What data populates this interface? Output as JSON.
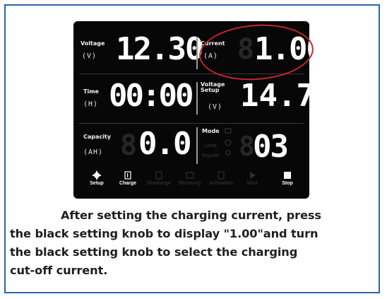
{
  "display": {
    "voltage": {
      "label": "Voltage",
      "unit": "(V)",
      "value": "12.30"
    },
    "current": {
      "label": "Current",
      "unit": "(A)",
      "value": "1.00"
    },
    "time": {
      "label": "Time",
      "unit": "(H)",
      "value": "00:00"
    },
    "voltage_setup": {
      "label": "Voltage Setup",
      "unit": "(V)",
      "value": "14.7"
    },
    "capacity": {
      "label": "Capacity",
      "unit": "(AH)",
      "value": "0.0"
    },
    "mode": {
      "label": "Mode",
      "options": [
        "Loop",
        "Inquire"
      ],
      "value": "03"
    }
  },
  "buttons": [
    {
      "label": "Setup",
      "active": true,
      "icon": "gear-icon"
    },
    {
      "label": "Charge",
      "active": true,
      "icon": "battery-icon"
    },
    {
      "label": "Discharge",
      "active": false,
      "icon": "battery-icon"
    },
    {
      "label": "Recovery",
      "active": false,
      "icon": "repair-icon"
    },
    {
      "label": "Activation",
      "active": false,
      "icon": "battery-icon"
    },
    {
      "label": "Start",
      "active": false,
      "icon": "play-icon"
    },
    {
      "label": "Stop",
      "active": true,
      "icon": "stop-icon"
    }
  ],
  "highlight_color": "#c8252a",
  "caption": {
    "line1": "After setting the charging current, press",
    "line2": "the black setting knob to display \"1.00\"and turn",
    "line3": "the black setting knob to select the charging",
    "line4": "cut-off current."
  }
}
